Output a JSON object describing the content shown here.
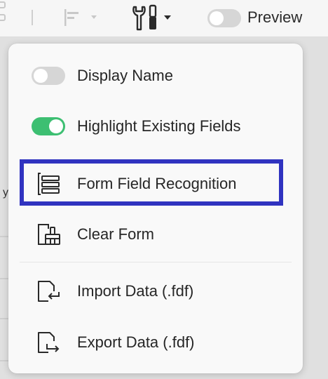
{
  "toolbar": {
    "preview_label": "Preview",
    "preview_enabled": false,
    "icons": [
      "align-left-icon",
      "dropdown-caret-icon",
      "wrench-screwdriver-icon",
      "dropdown-caret-icon"
    ]
  },
  "document": {
    "partial_text": "y"
  },
  "menu": {
    "items": [
      {
        "label": "Display Name",
        "type": "toggle",
        "enabled": false
      },
      {
        "label": "Highlight Existing Fields",
        "type": "toggle",
        "enabled": true
      },
      {
        "label": "Form Field Recognition",
        "icon": "form-recognition-icon",
        "highlighted": true
      },
      {
        "label": "Clear Form",
        "icon": "clear-form-icon"
      },
      {
        "label": "Import Data (.fdf)",
        "icon": "import-data-icon"
      },
      {
        "label": "Export Data (.fdf)",
        "icon": "export-data-icon"
      }
    ]
  },
  "colors": {
    "toggle_on": "#3dbf72",
    "toggle_off": "#d6d6d6",
    "highlight_border": "#3033c0",
    "menu_bg": "#f9f9f9"
  }
}
